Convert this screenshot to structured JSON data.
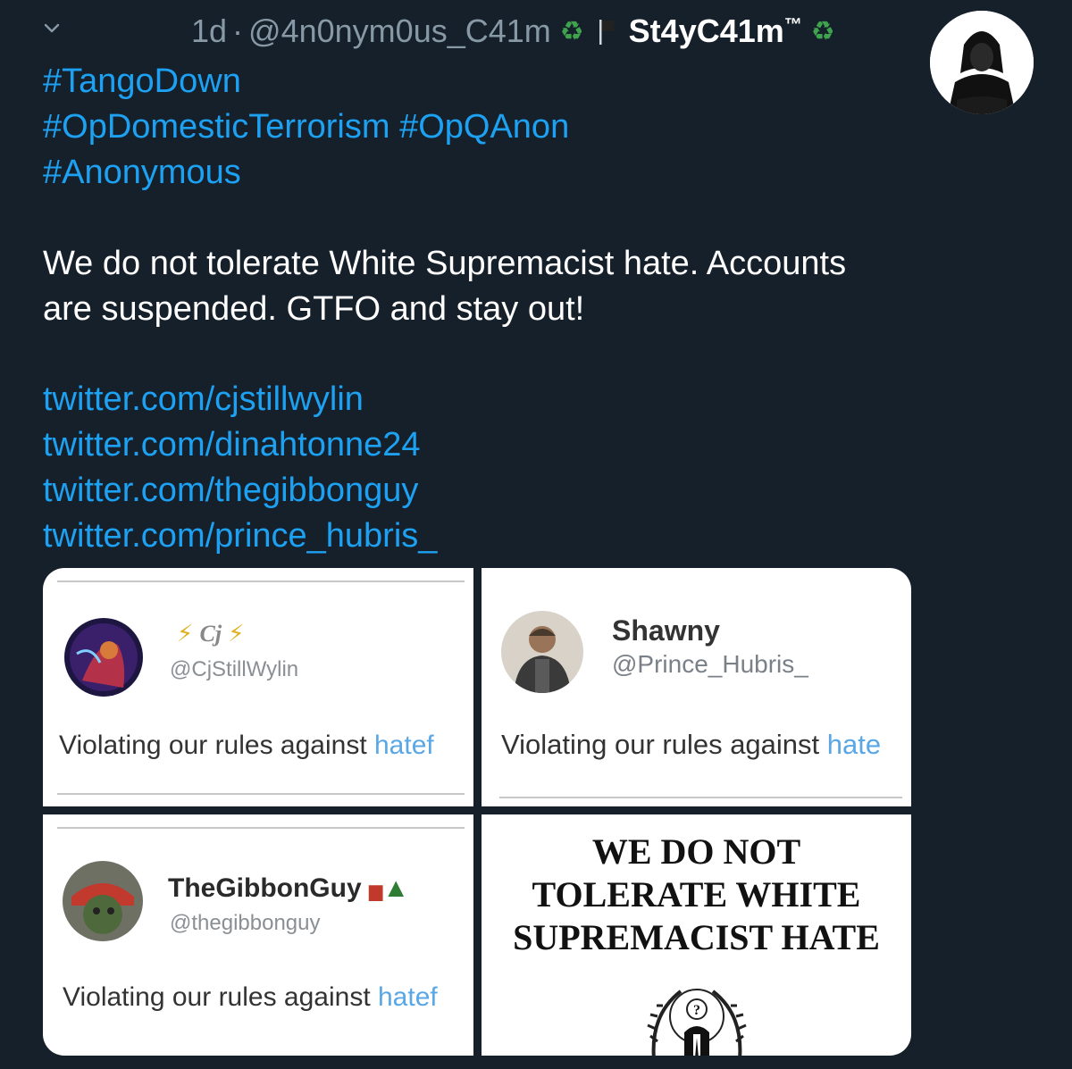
{
  "tweet": {
    "timestamp": "1d",
    "separator": "·",
    "handle": "@4n0nym0us_C41m",
    "display_name": "St4yC41m",
    "trademark": "™",
    "hashtags": [
      "#TangoDown",
      "#OpDomesticTerrorism #OpQAnon",
      "#Anonymous"
    ],
    "text_lines": [
      "We do not tolerate White Supremacist hate. Accounts",
      "are suspended. GTFO and stay out!"
    ],
    "links": [
      "twitter.com/cjstillwylin",
      "twitter.com/dinahtonne24",
      "twitter.com/thegibbonguy",
      "twitter.com/prince_hubris_"
    ]
  },
  "icons": {
    "chevron": "chevron-down-icon",
    "recycle": "recycle-icon",
    "flag": "black-flag-icon"
  },
  "colors": {
    "background": "#15202b",
    "link_blue": "#1da1f2",
    "muted": "#8899a6",
    "recycle_green": "#3fa34d"
  },
  "media": [
    {
      "name": "",
      "handle": "@CjStillWylin",
      "violation_prefix": "Violating our rules against ",
      "violation_link": "hatef"
    },
    {
      "name": "Shawny",
      "handle": "@Prince_Hubris_",
      "violation_prefix": "Violating our rules against ",
      "violation_link": "hate"
    },
    {
      "name": "TheGibbonGuy",
      "handle": "@thegibbonguy",
      "violation_prefix": "Violating our rules against ",
      "violation_link": "hatef"
    },
    {
      "poster_lines": [
        "WE DO NOT",
        "TOLERATE WHITE",
        "SUPREMACIST HATE"
      ],
      "logo_glyph": "?"
    }
  ]
}
